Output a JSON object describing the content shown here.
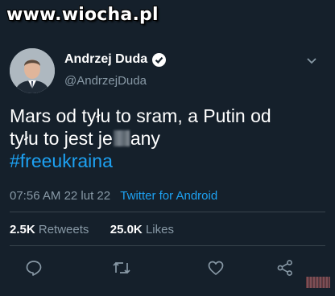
{
  "watermark": "www.wiocha.pl",
  "author": {
    "name": "Andrzej Duda",
    "handle": "@AndrzejDuda"
  },
  "tweet": {
    "line1": "Mars od tyłu to sram, a Putin od",
    "line2_start": "tyłu to jest je",
    "line2_end": "any",
    "hashtag": "#freeukraina"
  },
  "meta": {
    "time": "07:56 AM",
    "date": "22 lut 22",
    "source": "Twitter for Android"
  },
  "stats": {
    "retweets_count": "2.5K",
    "retweets_label": "Retweets",
    "likes_count": "25.0K",
    "likes_label": "Likes"
  },
  "colors": {
    "background": "#15202b",
    "accent": "#1da1f2",
    "muted": "#8899a6",
    "divider": "#38444d"
  },
  "icons": [
    "verified-icon",
    "chevron-down-icon",
    "reply-icon",
    "retweet-icon",
    "like-icon",
    "share-icon"
  ]
}
